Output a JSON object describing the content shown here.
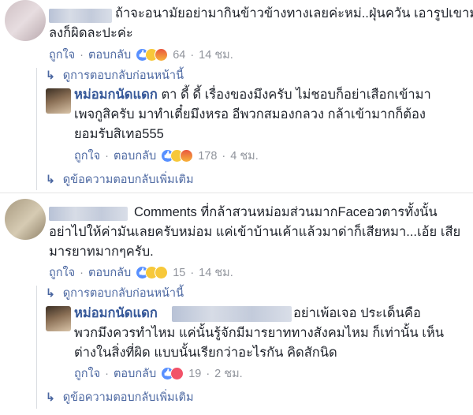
{
  "comments": [
    {
      "line1": "ถ้าจะอนามัยอย่ามากินข้าวข้างทางเลยค่ะหม่..ฝุ่นควัน เอารูปเขามา",
      "line2": "ลงก็ผิดละปะค่ะ",
      "like_label": "ถูกใจ",
      "reply_label": "ตอบกลับ",
      "reaction_icons": [
        "like-reaction",
        "haha-reaction",
        "angry-reaction"
      ],
      "reaction_count": "64",
      "time": "14 ชม.",
      "prev_replies_label": "ดูการตอบกลับก่อนหน้านี้",
      "reply": {
        "author": "หม่อมกนัดแดก",
        "line1_rest": " ตา ดี้ ดี้ เรื่องของมึงครับ ไม่ชอบก็อย่าเสือกเข้ามา",
        "line2": "เพจกูสิครับ มาทำเตี๋ยมึงหรอ อีพวกสมองกลวง กล้าเข้ามากก็ต้อง",
        "line3": "ยอมรับสิเทอ555",
        "like_label": "ถูกใจ",
        "reply_label": "ตอบกลับ",
        "reaction_icons": [
          "like-reaction",
          "haha-reaction",
          "angry-reaction"
        ],
        "reaction_count": "178",
        "time": "4 ชม."
      },
      "more_replies_label": "ดูข้อความตอบกลับเพิ่มเติม"
    },
    {
      "line1": "Comments ที่กล้าสวนหม่อมส่วนมากFaceอวตารทั้งนั้น",
      "line2": "อย่าไปให้ค่ามันเลยครับหม่อม แค่เข้าบ้านเค้าแล้วมาด่าก็เสียหมา...เอ้ย เสีย",
      "line3": "มารยาทมากๆครับ.",
      "like_label": "ถูกใจ",
      "reply_label": "ตอบกลับ",
      "reaction_icons": [
        "like-reaction",
        "wow-reaction",
        "sad-reaction"
      ],
      "reaction_count": "15",
      "time": "14 ชม.",
      "prev_replies_label": "ดูการตอบกลับก่อนหน้านี้",
      "reply": {
        "author": "หม่อมกนัดแดก",
        "line1_rest": "อย่าเพ้อเจอ ประเด็นคือ",
        "line2": "พวกมึงควรทำไหม แค่นั้นรู้จักมีมารยาททางสังคมไหม ก็เท่านั้น เห็น",
        "line3": "ต่างในสิ่งที่ผิด แบบนั้นเรียกว่าอะไรกัน คิดสักนิด",
        "like_label": "ถูกใจ",
        "reply_label": "ตอบกลับ",
        "reaction_icons": [
          "like-reaction",
          "love-reaction"
        ],
        "reaction_count": "19",
        "time": "2 ชม."
      },
      "more_replies_label": "ดูข้อความตอบกลับเพิ่มเติม"
    }
  ],
  "separator": "·",
  "colors": {
    "link": "#4b67a1",
    "author": "#365899",
    "meta": "#90949c"
  }
}
